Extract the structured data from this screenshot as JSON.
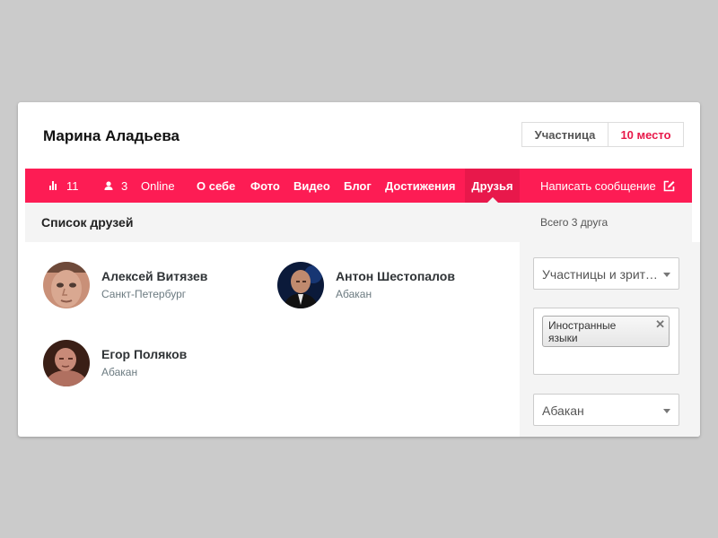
{
  "profile": {
    "name": "Марина Аладьева",
    "role": "Участница",
    "place": "10 место"
  },
  "nav": {
    "votes_count": "11",
    "friends_count": "3",
    "status": "Online",
    "links": [
      {
        "label": "О себе"
      },
      {
        "label": "Фото"
      },
      {
        "label": "Видео"
      },
      {
        "label": "Блог"
      },
      {
        "label": "Достижения"
      },
      {
        "label": "Друзья",
        "active": true
      }
    ],
    "message_label": "Написать сообщение",
    "icons": [
      "bar-chart-icon",
      "user-icon",
      "edit-icon"
    ]
  },
  "friends_section": {
    "title": "Список друзей",
    "total": "Всего 3 друга",
    "friends": [
      {
        "name": "Алексей Витязев",
        "city": "Санкт-Петербург"
      },
      {
        "name": "Антон Шестопалов",
        "city": "Абакан"
      },
      {
        "name": "Егор Поляков",
        "city": "Абакан"
      }
    ]
  },
  "filters": {
    "type_select": "Участницы и зрители",
    "tags": [
      {
        "label": "Иностранные языки"
      }
    ],
    "city_select": "Абакан"
  },
  "colors": {
    "accent": "#fd1c54",
    "accent_dark": "#e8184b",
    "place_text": "#e8194a",
    "background": "#cbcbcb"
  }
}
